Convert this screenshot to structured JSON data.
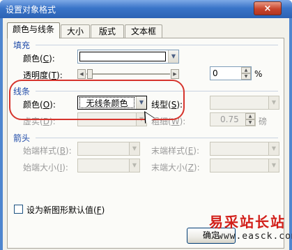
{
  "window": {
    "title": "设置对象格式",
    "close_glyph": "×"
  },
  "tabs": [
    "颜色与线条",
    "大小",
    "版式",
    "文本框"
  ],
  "fill": {
    "section": "填充",
    "color_label": "颜色(",
    "color_key": "C",
    "color_tail": "):",
    "transparency_label": "透明度(",
    "transparency_key": "T",
    "transparency_tail": "):",
    "transparency_value": "0",
    "percent": "%"
  },
  "line": {
    "section": "线条",
    "color_label": "颜色(",
    "color_key": "O",
    "color_tail": "):",
    "color_value": "无线条颜色",
    "style_label": "线型(",
    "style_key": "S",
    "style_tail": "):",
    "dash_label": "虚实(",
    "dash_key": "D",
    "dash_tail": "):",
    "weight_label": "粗细(",
    "weight_key": "W",
    "weight_tail": "):",
    "weight_value": "0.75",
    "weight_unit": "磅"
  },
  "arrows": {
    "section": "箭头",
    "begin_style_label": "始端样式(",
    "begin_style_key": "B",
    "begin_style_tail": "):",
    "end_style_label": "末端样式(",
    "end_style_key": "E",
    "end_style_tail": "):",
    "begin_size_label": "始端大小(",
    "begin_size_key": "I",
    "begin_size_tail": "):",
    "end_size_label": "末端大小(",
    "end_size_key": "Z",
    "end_size_tail": "):"
  },
  "default_checkbox": {
    "label": "设为新图形默认值(",
    "key": "F",
    "tail": ")"
  },
  "ok_button": "确定",
  "watermark": {
    "text": "易采站长站",
    "url": "www.easck.com"
  },
  "colors": {
    "accent": "#1e4aa8",
    "highlight": "#d6342c",
    "titlebar": "#3a74c8"
  }
}
